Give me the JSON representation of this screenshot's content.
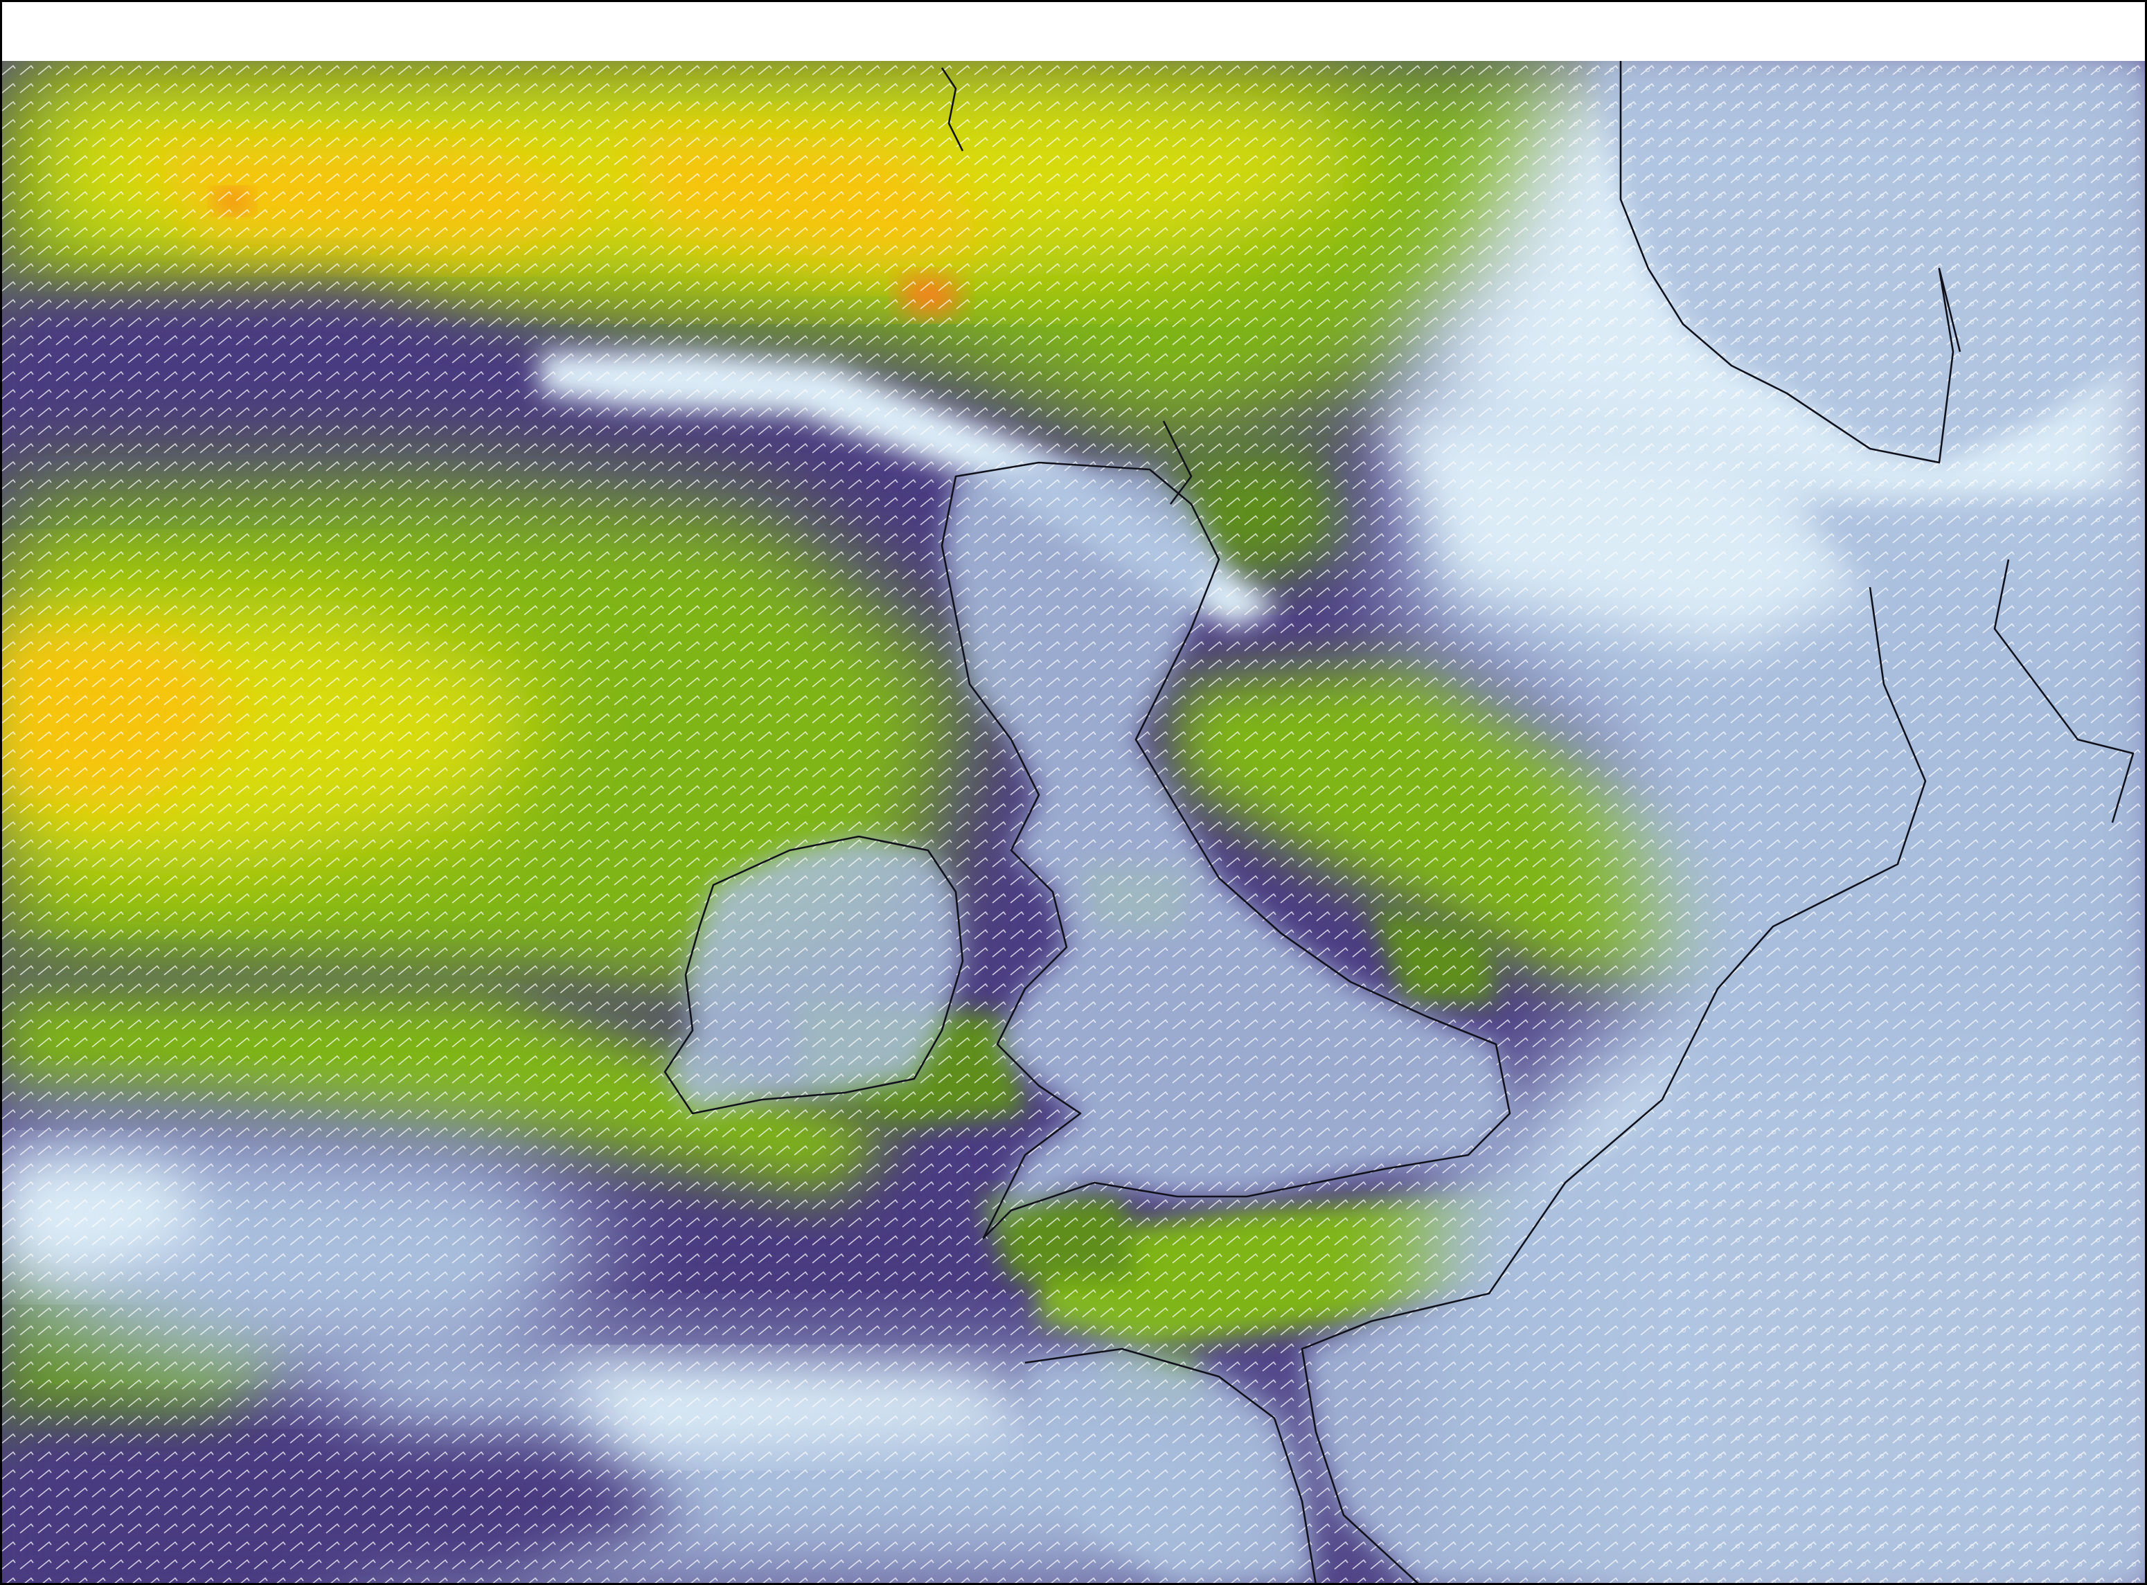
{
  "map": {
    "kind": "wind speed field with wind barbs",
    "basemap_outline": "#10101a",
    "barb_color": "#ffffff",
    "palette": {
      "calm": "#dcecf7",
      "light": "#a9bedd",
      "moderate_low": "#5a5290",
      "moderate": "#4a3a80",
      "fresh": "#5f8e1c",
      "strong": "#7fb516",
      "very_strong": "#d9dc10",
      "gale": "#f7c40e",
      "storm": "#f4821c"
    },
    "visible_text": []
  }
}
